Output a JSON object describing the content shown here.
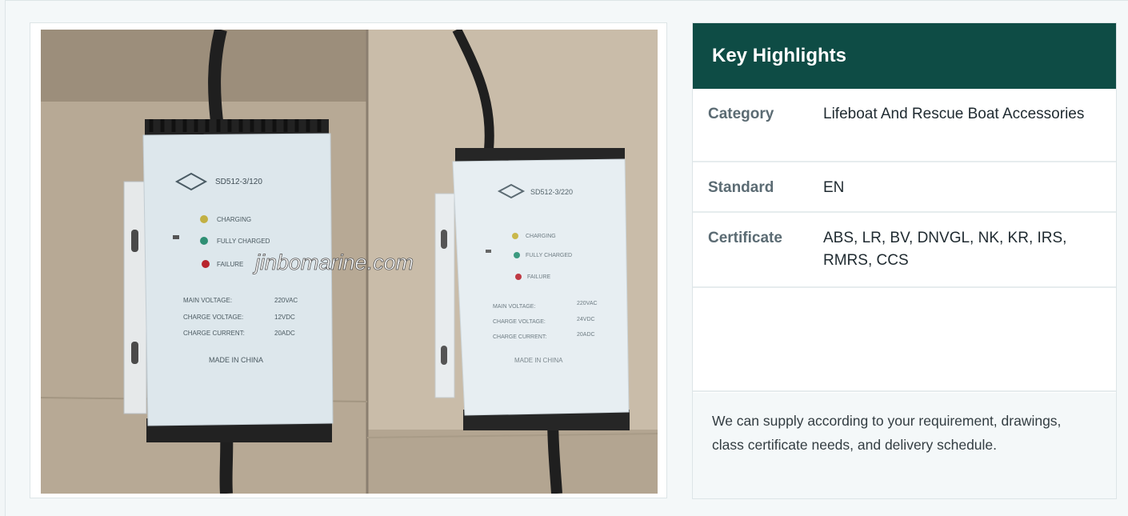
{
  "highlights": {
    "title": "Key Highlights",
    "rows": [
      {
        "label": "Category",
        "value": "Lifeboat And Rescue Boat Accessories"
      },
      {
        "label": "Standard",
        "value": "EN"
      },
      {
        "label": "Certificate",
        "value": "ABS, LR, BV, DNVGL, NK, KR, IRS, RMRS, CCS"
      }
    ],
    "note": "We can supply according to your requirement, drawings, class certificate needs, and delivery schedule."
  },
  "photo": {
    "watermark": "jinbomarine.com",
    "left_unit": {
      "model": "SD512-3/120",
      "leds": [
        "CHARGING",
        "FULLY CHARGED",
        "FAILURE"
      ],
      "spec_labels": [
        "MAIN VOLTAGE:",
        "CHARGE VOLTAGE:",
        "CHARGE CURRENT:"
      ],
      "spec_values": [
        "220VAC",
        "12VDC",
        "20ADC"
      ],
      "origin": "MADE IN CHINA"
    },
    "right_unit": {
      "model": "SD512-3/220",
      "leds": [
        "CHARGING",
        "FULLY CHARGED",
        "FAILURE"
      ],
      "spec_labels": [
        "MAIN VOLTAGE:",
        "CHARGE VOLTAGE:",
        "CHARGE CURRENT:"
      ],
      "spec_values": [
        "220VAC",
        "24VDC",
        "20ADC"
      ],
      "origin": "MADE IN CHINA"
    }
  }
}
